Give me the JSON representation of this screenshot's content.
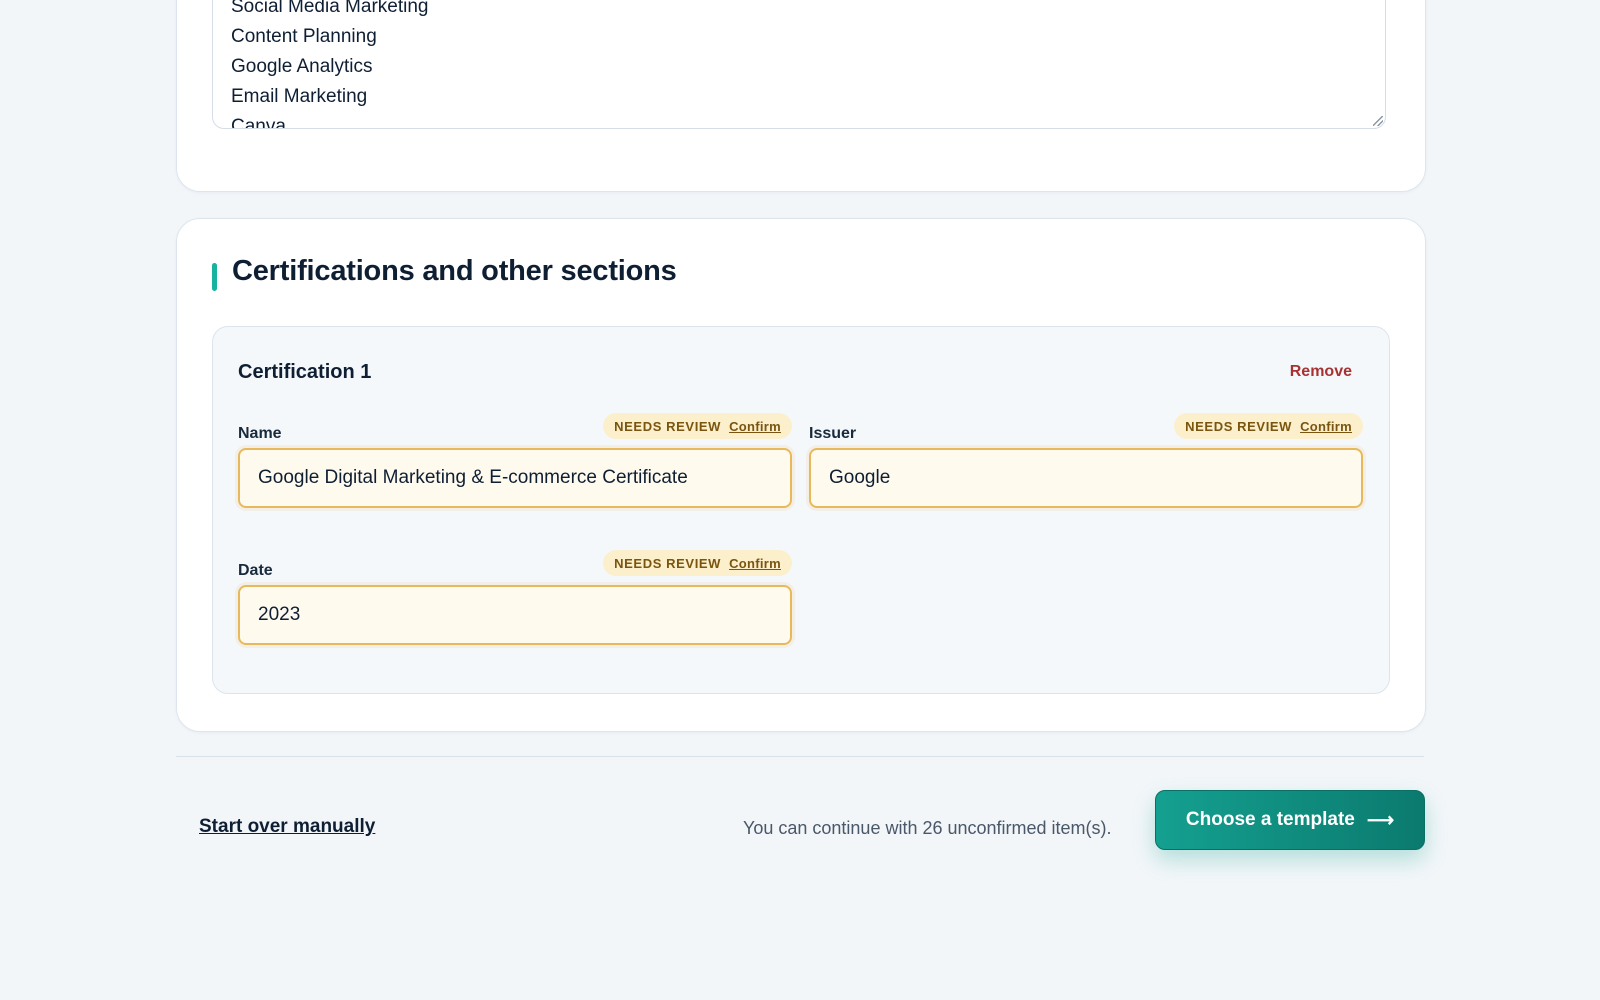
{
  "skills": {
    "lines": [
      "Social Media Marketing",
      "Content Planning",
      "Google Analytics",
      "Email Marketing",
      "Canva"
    ]
  },
  "certifications": {
    "section_title": "Certifications and other sections",
    "items": [
      {
        "title": "Certification 1",
        "remove_label": "Remove",
        "fields": {
          "name": {
            "label": "Name",
            "value": "Google Digital Marketing & E-commerce Certificate",
            "badge": "NEEDS REVIEW",
            "confirm": "Confirm"
          },
          "issuer": {
            "label": "Issuer",
            "value": "Google",
            "badge": "NEEDS REVIEW",
            "confirm": "Confirm"
          },
          "date": {
            "label": "Date",
            "value": "2023",
            "badge": "NEEDS REVIEW",
            "confirm": "Confirm"
          }
        }
      }
    ]
  },
  "footer": {
    "start_over_label": "Start over manually",
    "continue_note": "You can continue with 26 unconfirmed item(s).",
    "cta_label": "Choose a template",
    "cta_arrow": "⟶"
  },
  "colors": {
    "accent": "#16b3a0",
    "cta": "#0f8f80",
    "review_badge": "#fbefcc",
    "review_border": "#e8b95c",
    "remove": "#a83232"
  }
}
